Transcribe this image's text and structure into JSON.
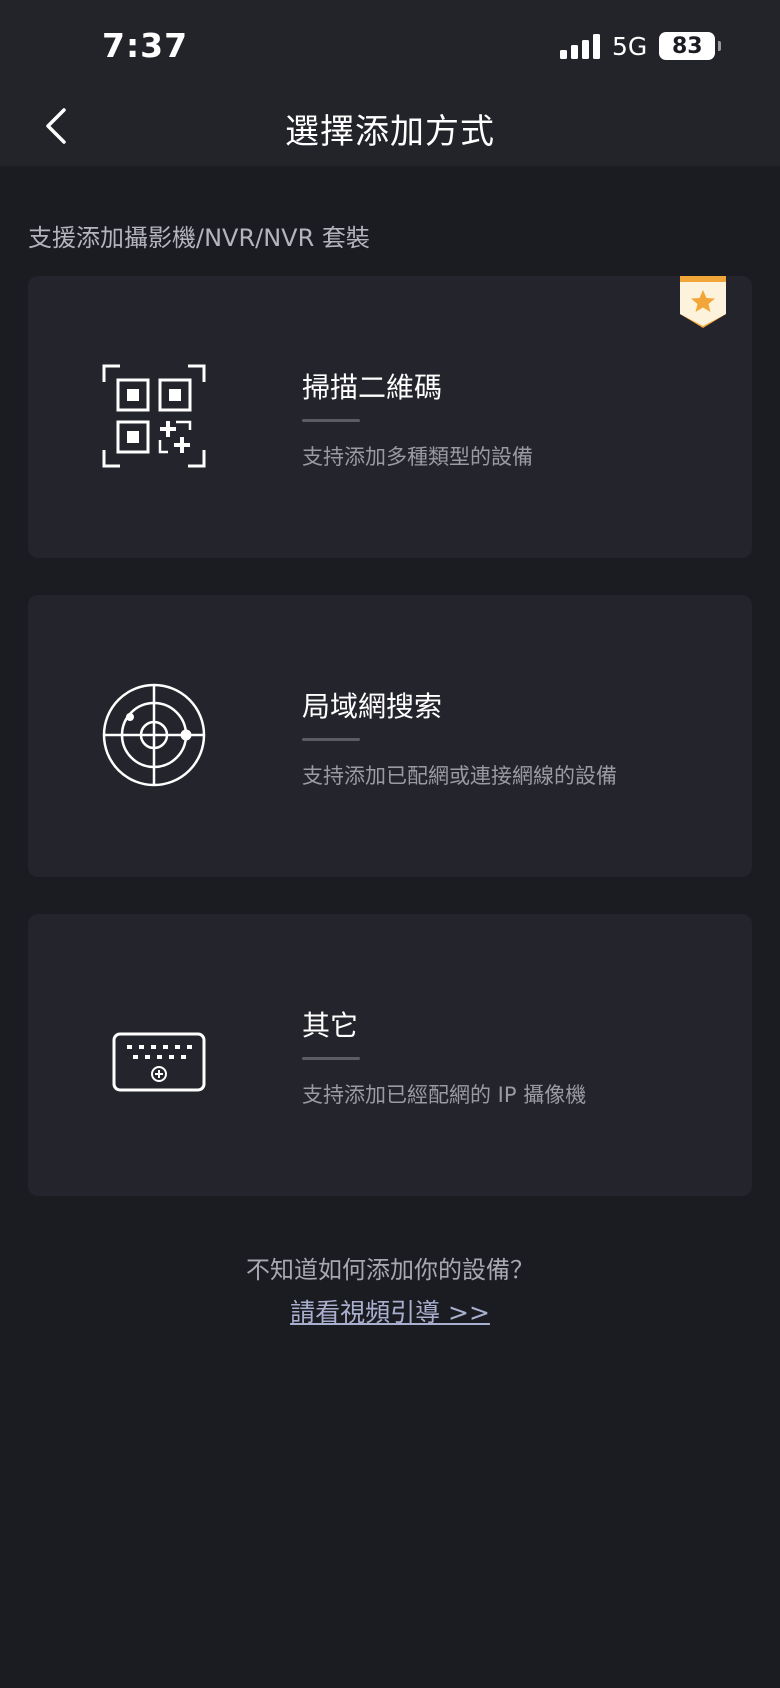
{
  "status_bar": {
    "time": "7:37",
    "network": "5G",
    "battery": "83"
  },
  "nav": {
    "title": "選擇添加方式",
    "back_icon": "chevron-left-icon"
  },
  "section_label": "支援添加攝影機/NVR/NVR 套裝",
  "options": [
    {
      "title": "掃描二維碼",
      "desc": "支持添加多種類型的設備",
      "icon": "qr-code-scan-icon",
      "badge": "star-badge-icon"
    },
    {
      "title": "局域網搜索",
      "desc": "支持添加已配網或連接網線的設備",
      "icon": "radar-icon"
    },
    {
      "title": "其它",
      "desc": "支持添加已經配網的 IP 攝像機",
      "icon": "ip-camera-keyboard-icon"
    }
  ],
  "help": {
    "question": "不知道如何添加你的設備？",
    "link": "請看視頻引導 >>"
  },
  "colors": {
    "background": "#1b1b22",
    "card": "#24242c",
    "badge": "#f2a63a",
    "link": "#a9b0cf"
  }
}
